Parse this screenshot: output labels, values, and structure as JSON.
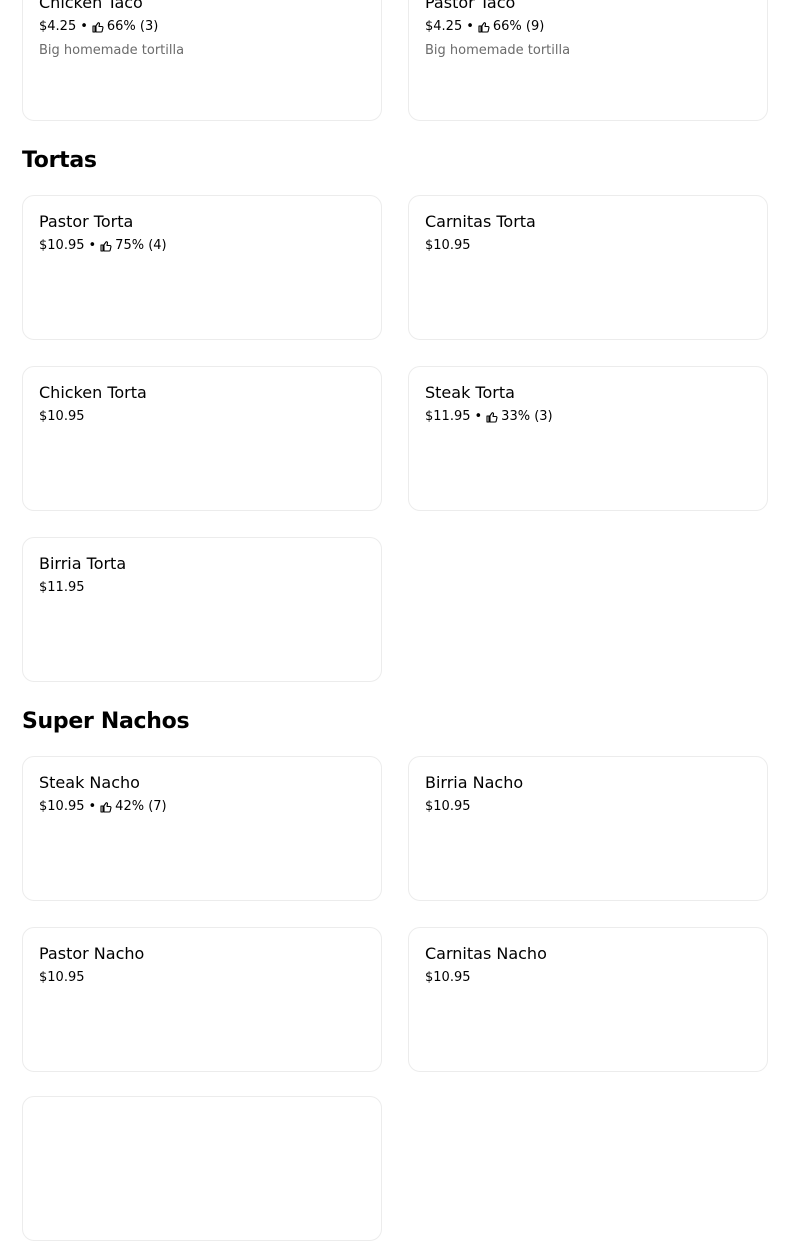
{
  "colors": {
    "text": "#000000",
    "muted": "#6b6b6b",
    "card_border": "#ececec"
  },
  "icons": {
    "rating": "thumbs-up-icon"
  },
  "tacos": {
    "items": [
      {
        "name": "Chicken Taco",
        "price": "$4.25",
        "sep": "•",
        "rating": "66% (3)",
        "description": "Big homemade tortilla"
      },
      {
        "name": "Pastor Taco",
        "price": "$4.25",
        "sep": "•",
        "rating": "66% (9)",
        "description": "Big homemade tortilla"
      }
    ]
  },
  "tortas": {
    "title": "Tortas",
    "items": [
      {
        "name": "Pastor Torta",
        "price": "$10.95",
        "sep": "•",
        "rating": "75% (4)"
      },
      {
        "name": "Carnitas Torta",
        "price": "$10.95"
      },
      {
        "name": "Chicken Torta",
        "price": "$10.95"
      },
      {
        "name": "Steak Torta",
        "price": "$11.95",
        "sep": "•",
        "rating": "33% (3)"
      },
      {
        "name": "Birria Torta",
        "price": "$11.95"
      }
    ]
  },
  "nachos": {
    "title": "Super Nachos",
    "items": [
      {
        "name": "Steak Nacho",
        "price": "$10.95",
        "sep": "•",
        "rating": "42% (7)"
      },
      {
        "name": "Birria Nacho",
        "price": "$10.95"
      },
      {
        "name": "Pastor Nacho",
        "price": "$10.95"
      },
      {
        "name": "Carnitas Nacho",
        "price": "$10.95"
      }
    ]
  }
}
